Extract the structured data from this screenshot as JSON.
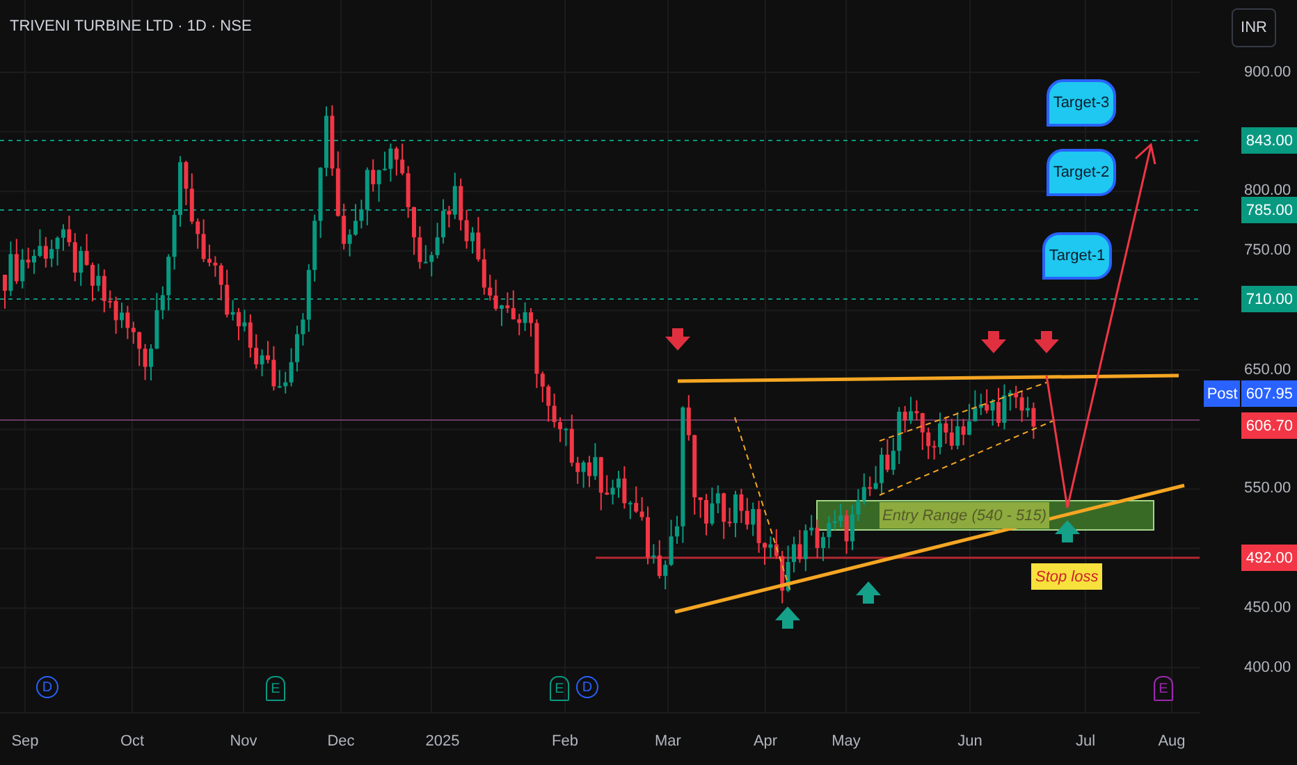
{
  "header": {
    "title": "TRIVENI TURBINE LTD · 1D · NSE",
    "currency_button": "INR"
  },
  "price_axis": {
    "ticks": [
      "900.00",
      "800.00",
      "750.00",
      "650.00",
      "550.00",
      "450.00",
      "400.00"
    ],
    "tags": [
      {
        "kind": "level",
        "text": "843.00",
        "color": "#089981"
      },
      {
        "kind": "level",
        "text": "785.00",
        "color": "#089981"
      },
      {
        "kind": "level",
        "text": "710.00",
        "color": "#089981"
      },
      {
        "kind": "post",
        "label": "Post",
        "text": "607.95",
        "color": "#2962ff"
      },
      {
        "kind": "level",
        "text": "606.70",
        "color": "#f23645"
      },
      {
        "kind": "level",
        "text": "492.00",
        "color": "#f23645"
      }
    ]
  },
  "time_axis": {
    "labels": [
      "Sep",
      "Oct",
      "Nov",
      "Dec",
      "2025",
      "Feb",
      "Mar",
      "Apr",
      "May",
      "Jun",
      "Jul",
      "Aug"
    ]
  },
  "events": [
    {
      "kind": "dividend",
      "letter": "D",
      "color": "#2962ff"
    },
    {
      "kind": "earnings",
      "letter": "E",
      "color": "#089981"
    },
    {
      "kind": "earnings",
      "letter": "E",
      "color": "#089981"
    },
    {
      "kind": "dividend",
      "letter": "D",
      "color": "#2962ff"
    },
    {
      "kind": "earnings",
      "letter": "E",
      "color": "#9c27b0"
    }
  ],
  "annotations": {
    "targets": [
      "Target-3",
      "Target-2",
      "Target-1"
    ],
    "entry_range": "Entry Range (540 - 515)",
    "stop_loss": "Stop loss"
  }
}
